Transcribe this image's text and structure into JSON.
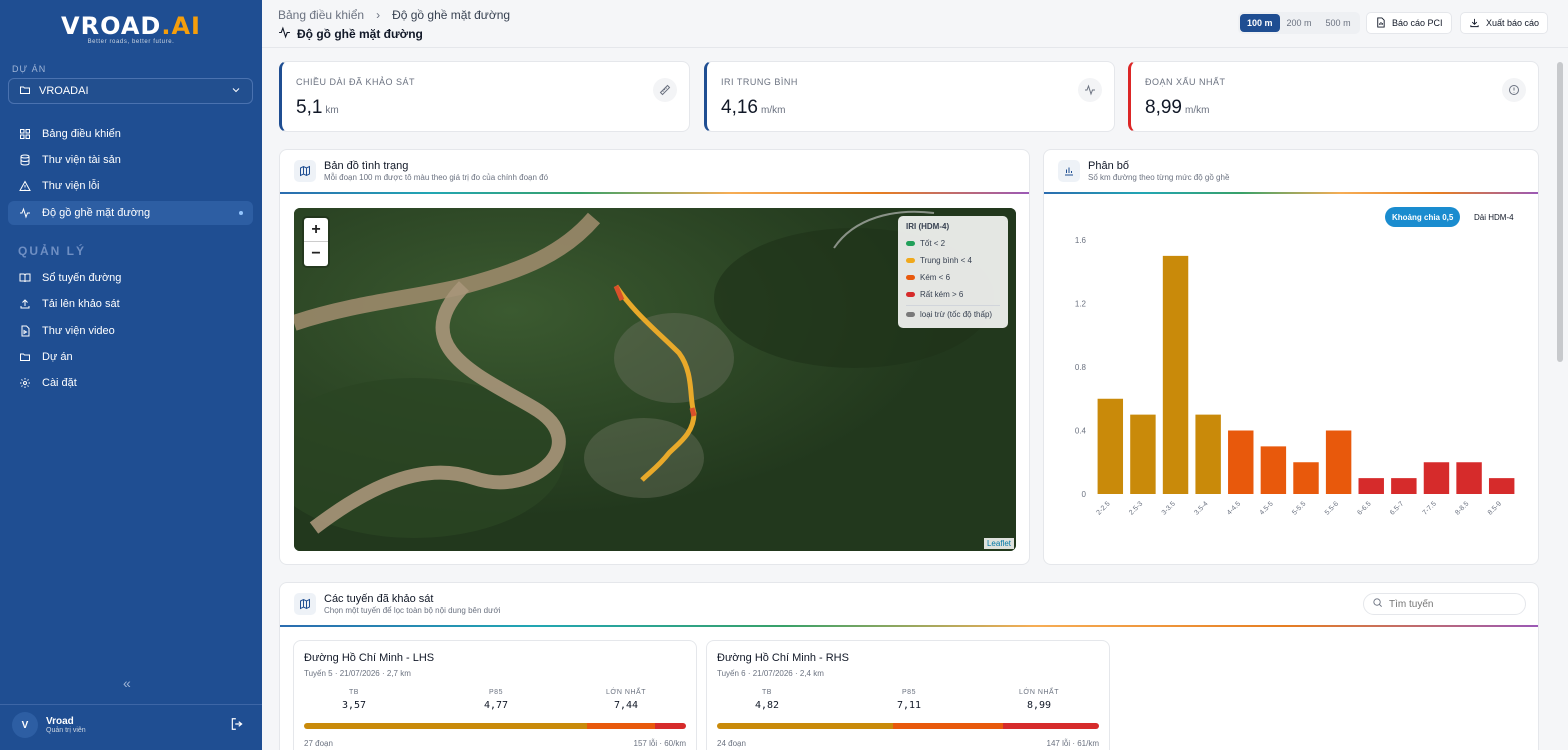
{
  "brand": {
    "name_main": "VROAD",
    "name_accent": ".AI",
    "tagline": "Better roads, better future."
  },
  "sidebar": {
    "project_section": "DỰ ÁN",
    "project": "VROADAI",
    "items": [
      {
        "label": "Bảng điều khiển",
        "icon": "grid-icon"
      },
      {
        "label": "Thư viện tài sản",
        "icon": "database-icon"
      },
      {
        "label": "Thư viện lỗi",
        "icon": "warning-icon"
      },
      {
        "label": "Độ gồ ghề mặt đường",
        "icon": "activity-icon",
        "active": true
      }
    ],
    "management_section": "QUẢN LÝ",
    "management_items": [
      {
        "label": "Sổ tuyến đường",
        "icon": "book-icon"
      },
      {
        "label": "Tải lên khảo sát",
        "icon": "upload-icon"
      },
      {
        "label": "Thư viện video",
        "icon": "video-file-icon"
      },
      {
        "label": "Dự án",
        "icon": "folder-icon"
      },
      {
        "label": "Cài đặt",
        "icon": "gear-icon"
      }
    ],
    "collapse": "«",
    "user": {
      "initial": "V",
      "name": "Vroad",
      "role": "Quản trị viên"
    }
  },
  "topbar": {
    "breadcrumb": [
      "Bảng điều khiển",
      "Độ gồ ghề mặt đường"
    ],
    "title": "Độ gồ ghề mặt đường",
    "intervals": [
      "100 m",
      "200 m",
      "500 m"
    ],
    "selected_interval": "100 m",
    "pci_button": "Báo cáo PCI",
    "export_button": "Xuất báo cáo"
  },
  "stats": [
    {
      "label": "CHIỀU DÀI ĐÃ KHẢO SÁT",
      "value": "5,1",
      "unit": "km",
      "icon": "ruler-icon"
    },
    {
      "label": "IRI TRUNG BÌNH",
      "value": "4,16",
      "unit": "m/km",
      "icon": "activity-icon"
    },
    {
      "label": "ĐOẠN XẤU NHẤT",
      "value": "8,99",
      "unit": "m/km",
      "icon": "alert-circle-icon"
    }
  ],
  "map_panel": {
    "title": "Bản đồ tình trạng",
    "subtitle": "Mỗi đoạn 100 m được tô màu theo giá trị đo của chính đoạn đó",
    "legend_title": "IRI (HDM-4)",
    "legend": [
      {
        "label": "Tốt < 2",
        "color": "#22a05a"
      },
      {
        "label": "Trung bình < 4",
        "color": "#f0a91c"
      },
      {
        "label": "Kém < 6",
        "color": "#e8590c"
      },
      {
        "label": "Rất kém > 6",
        "color": "#d62b2b"
      },
      {
        "label": "loại trừ (tốc độ thấp)",
        "color": "#7a7a7a"
      }
    ],
    "attribution": "Leaflet"
  },
  "chart_panel": {
    "title": "Phân bố",
    "subtitle": "Số km đường theo từng mức độ gồ ghề",
    "toggle_on": "Khoảng chia 0,5",
    "toggle_off": "Dải HDM-4"
  },
  "chart_data": {
    "type": "bar",
    "categories": [
      "2-2.5",
      "2.5-3",
      "3-3.5",
      "3.5-4",
      "4-4.5",
      "4.5-5",
      "5-5.5",
      "5.5-6",
      "6-6.5",
      "6.5-7",
      "7-7.5",
      "8-8.5",
      "8.5-9"
    ],
    "values": [
      0.6,
      0.5,
      1.5,
      0.5,
      0.4,
      0.3,
      0.2,
      0.4,
      0.1,
      0.1,
      0.2,
      0.2,
      0.1
    ],
    "colors": [
      "#c98a0a",
      "#c98a0a",
      "#c98a0a",
      "#c98a0a",
      "#e8590c",
      "#e8590c",
      "#e8590c",
      "#e8590c",
      "#d62b2b",
      "#d62b2b",
      "#d62b2b",
      "#d62b2b",
      "#d62b2b"
    ],
    "yticks": [
      "0",
      "0.4",
      "0.8",
      "1.2",
      "1.6"
    ],
    "ylim": [
      0,
      1.6
    ],
    "grid": false
  },
  "routes_panel": {
    "title": "Các tuyến đã khảo sát",
    "subtitle": "Chọn một tuyến để lọc toàn bộ nội dung bên dưới",
    "search_placeholder": "Tìm tuyến",
    "metric_labels": [
      "TB",
      "P85",
      "LỚN NHẤT"
    ],
    "routes": [
      {
        "name": "Đường Hồ Chí Minh - LHS",
        "meta": "Tuyến 5 · 21/07/2026 · 2,7 km",
        "tb": "3,57",
        "p85": "4,77",
        "max": "7,44",
        "segments": "27 đoạn",
        "defects": "157 lỗi · 60/km",
        "bar": [
          {
            "share": 0.74,
            "color": "#c98a0a"
          },
          {
            "share": 0.18,
            "color": "#e8590c"
          },
          {
            "share": 0.08,
            "color": "#d62b2b"
          }
        ]
      },
      {
        "name": "Đường Hồ Chí Minh - RHS",
        "meta": "Tuyến 6 · 21/07/2026 · 2,4 km",
        "tb": "4,82",
        "p85": "7,11",
        "max": "8,99",
        "segments": "24 đoạn",
        "defects": "147 lỗi · 61/km",
        "bar": [
          {
            "share": 0.46,
            "color": "#c98a0a"
          },
          {
            "share": 0.29,
            "color": "#e8590c"
          },
          {
            "share": 0.25,
            "color": "#d62b2b"
          }
        ]
      }
    ]
  }
}
